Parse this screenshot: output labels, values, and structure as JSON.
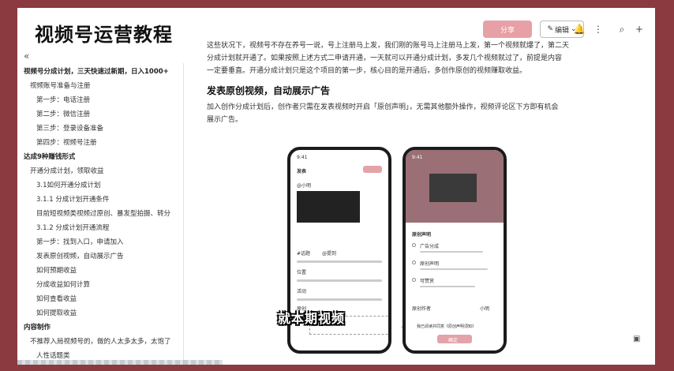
{
  "overlay_title": "视频号运营教程",
  "topbar": {
    "publish_label": "分享",
    "edit_label": "编辑",
    "edit_icon": "pencil-icon",
    "dropdown_icon": "chevron-down-icon",
    "icons": [
      "bell-icon",
      "more-icon",
      "search-icon",
      "plus-icon"
    ]
  },
  "sidebar": {
    "collapse_glyph": "«",
    "items": [
      {
        "label": "视频号分成计划，三天快速过新期，日入1000+",
        "level": 0
      },
      {
        "label": "视频账号准备与注册",
        "level": 1
      },
      {
        "label": "第一步：电话注册",
        "level": 2
      },
      {
        "label": "第二步：微信注册",
        "level": 2
      },
      {
        "label": "第三步：登录设备准备",
        "level": 2
      },
      {
        "label": "第四步：视频号注册",
        "level": 2
      },
      {
        "label": "达成9种赚钱形式",
        "level": 0
      },
      {
        "label": "开通分成计划，领取收益",
        "level": 1
      },
      {
        "label": "3.1如何开通分成计划",
        "level": 2
      },
      {
        "label": "3.1.1 分成计划开通条件",
        "level": 2
      },
      {
        "label": "目前短视频类视频过原创、暴发型拍摄、转分",
        "level": 2
      },
      {
        "label": "3.1.2 分成计划开通流程",
        "level": 2
      },
      {
        "label": "第一步：找到入口，申请加入",
        "level": 2
      },
      {
        "label": "发表原创视频，自动展示广告",
        "level": 2
      },
      {
        "label": "如何预期收益",
        "level": 2
      },
      {
        "label": "分成收益如何计算",
        "level": 2
      },
      {
        "label": "如何查看收益",
        "level": 2
      },
      {
        "label": "如何提取收益",
        "level": 2
      },
      {
        "label": "内容制作",
        "level": 0
      },
      {
        "label": "不推荐入局视频号的，做的人太多太多，太饱了",
        "level": 1
      },
      {
        "label": "人性话题类",
        "level": 2
      }
    ]
  },
  "main": {
    "para1_line1": "这些状况下，视频号不存在养号一说，号上注册马上发，我们刚的账号马上注册马上发，第一个视频就爆了，第二天",
    "para1_line2": "分成计划就开通了。如果按照上述方式二申请开通，一天就可以开通分成计划，多发几个视频就过了，前提是内容",
    "para1_line3": "一定要垂直。开通分成计划只是这个项目的第一步，核心目的是开通后，多创作原创的视频赚取收益。",
    "heading": "发表原创视频，自动展示广告",
    "para2_line1": "加入创作分成计划后，创作者只需在发表视频时开启「原创声明」，无需其他额外操作，视频评论区下方即有机会",
    "para2_line2": "展示广告。"
  },
  "phone_left": {
    "time": "9:41",
    "header": "发表",
    "user": "@小明",
    "fields": [
      "#话题",
      "@提到"
    ],
    "rows": [
      "位置",
      "活动",
      "原创"
    ]
  },
  "phone_right": {
    "time": "9:41",
    "sheet_title": "原创声明",
    "options": [
      "广告分成",
      "原创声明",
      "可赞赏"
    ],
    "footer_left": "原创作者",
    "footer_right": "小明",
    "agree": "我已阅读并同意《原创声明须知》",
    "confirm": "确定"
  },
  "arrow_glyph": "→",
  "caption": "就本期视频",
  "right_icon": "bookmark-icon"
}
